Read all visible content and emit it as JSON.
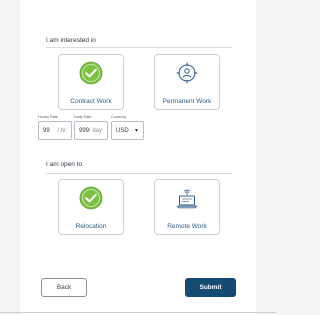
{
  "interested": {
    "title": "I am interested in",
    "options": [
      {
        "label": "Contract Work",
        "icon": "check-circle-icon",
        "selected": true
      },
      {
        "label": "Permanent Work",
        "icon": "target-person-icon",
        "selected": false
      }
    ]
  },
  "rates": {
    "hourly": {
      "caption": "Hourly Rate",
      "value": "99",
      "unit": "/ hr"
    },
    "daily": {
      "caption": "Daily Rate",
      "value": "999",
      "unit": "/ day"
    },
    "currency": {
      "caption": "Currency",
      "value": "USD"
    }
  },
  "open_to": {
    "title": "I am open to",
    "options": [
      {
        "label": "Relocation",
        "icon": "check-circle-icon",
        "selected": true
      },
      {
        "label": "Remote Work",
        "icon": "laptop-wifi-icon",
        "selected": false
      }
    ]
  },
  "buttons": {
    "back": "Back",
    "submit": "Submit"
  },
  "colors": {
    "accent_green": "#7cc242",
    "brand_blue": "#134b73",
    "link_blue": "#2a5d8a"
  }
}
